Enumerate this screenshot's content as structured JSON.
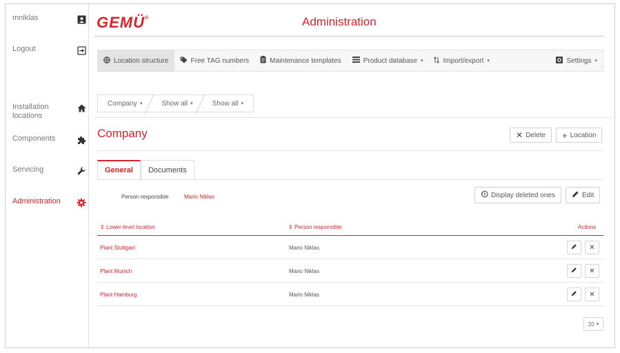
{
  "sidebar": {
    "user": "mniklas",
    "logout": "Logout",
    "items": [
      {
        "label": "Installation locations",
        "icon": "home-icon"
      },
      {
        "label": "Components",
        "icon": "puzzle-icon"
      },
      {
        "label": "Servicing",
        "icon": "wrench-icon"
      },
      {
        "label": "Administration",
        "icon": "gear-icon",
        "active": true
      }
    ]
  },
  "header": {
    "logo": "GEMÜ",
    "logo_mark": "®",
    "title": "Administration"
  },
  "nav": {
    "items": [
      {
        "label": "Location structure",
        "icon": "globe-icon",
        "active": true
      },
      {
        "label": "Free TAG numbers",
        "icon": "tag-icon"
      },
      {
        "label": "Maintenance templates",
        "icon": "clipboard-icon"
      },
      {
        "label": "Product database",
        "icon": "list-icon",
        "dropdown": true
      },
      {
        "label": "Import/export",
        "icon": "sort-icon",
        "dropdown": true
      }
    ],
    "settings": "Settings"
  },
  "breadcrumb": [
    "Company",
    "Show all",
    "Show all"
  ],
  "section": {
    "title": "Company",
    "delete_label": "Delete",
    "add_location_label": "Location"
  },
  "tabs": [
    "General",
    "Documents"
  ],
  "details": {
    "person_label": "Person responsible",
    "person_value": "Mario Niklas",
    "display_deleted_label": "Display deleted ones",
    "edit_label": "Edit"
  },
  "table": {
    "columns": [
      "Lower-level location",
      "Person responsible",
      "Actions"
    ],
    "rows": [
      {
        "location": "Plant Stuttgart",
        "person": "Mario Niklas"
      },
      {
        "location": "Plant Munich",
        "person": "Mario Niklas"
      },
      {
        "location": "Plant Hamburg",
        "person": "Mario Niklas"
      }
    ]
  },
  "pagination": {
    "page_size": "20"
  },
  "colors": {
    "accent": "#d8232a",
    "border": "#dddddd",
    "nav_bg": "#f7f7f7"
  }
}
